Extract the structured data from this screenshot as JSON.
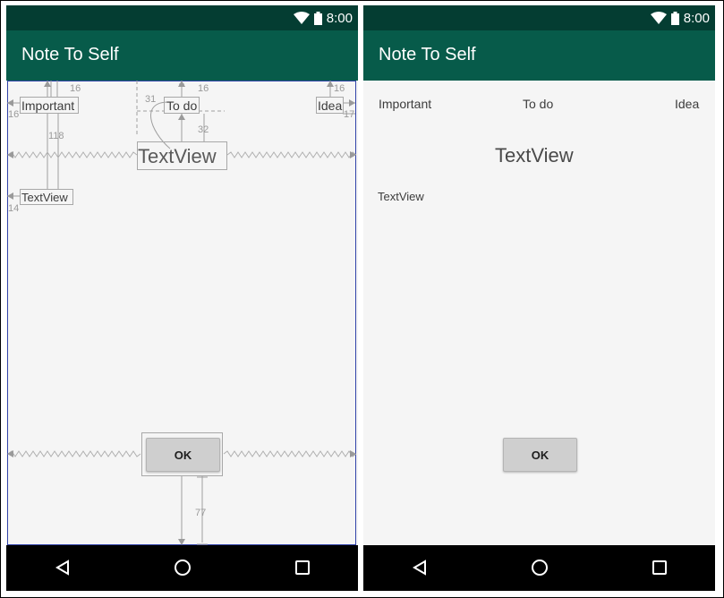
{
  "status_bar": {
    "time": "8:00",
    "icons": [
      "wifi-icon",
      "battery-icon"
    ]
  },
  "app": {
    "title": "Note To Self"
  },
  "layout": {
    "important_label": "Important",
    "todo_label": "To do",
    "idea_label": "Idea",
    "title_text": "TextView",
    "body_text": "TextView",
    "ok_label": "OK"
  },
  "blueprint": {
    "dimensions": [
      "16",
      "16",
      "16",
      "31",
      "118",
      "32",
      "16",
      "17",
      "14",
      "77"
    ]
  },
  "nav": {
    "icons": [
      "back-icon",
      "home-icon",
      "recents-icon"
    ]
  },
  "colors": {
    "status_bar": "#043d32",
    "app_bar": "#075b4a",
    "nav_bar": "#000000",
    "background": "#f5f5f5",
    "blueprint_border": "#3344aa"
  }
}
